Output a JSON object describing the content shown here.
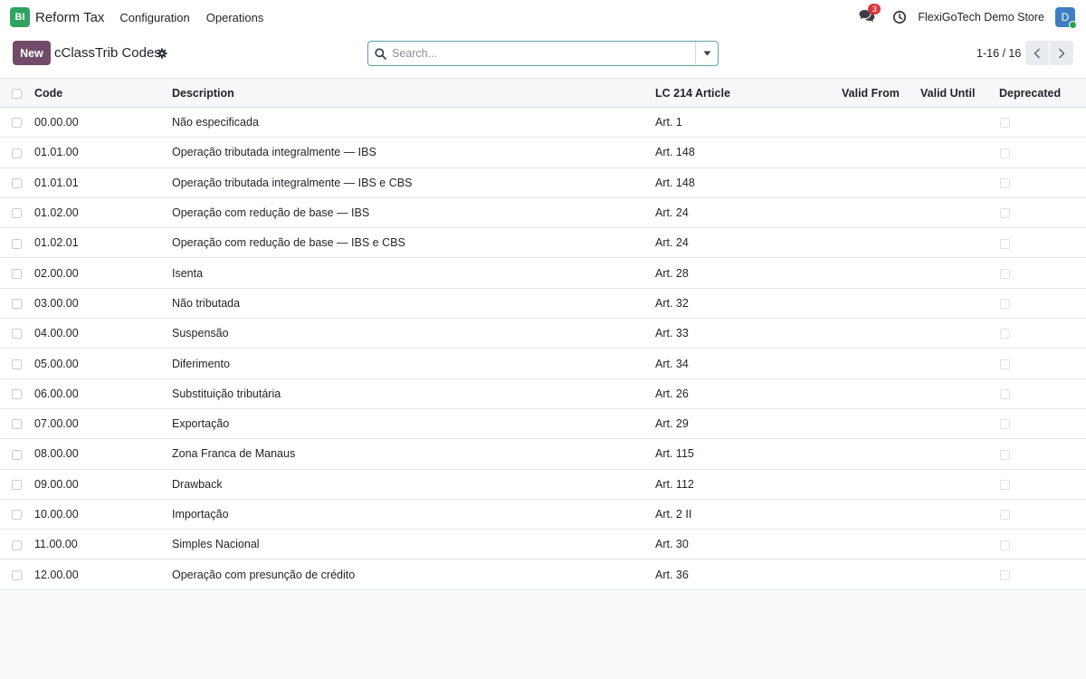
{
  "navbar": {
    "app_logo": "BI",
    "app_name": "Reform Tax",
    "menus": [
      "Configuration",
      "Operations"
    ],
    "messages_badge": "3",
    "company": "FlexiGoTech Demo Store",
    "avatar_letter": "D"
  },
  "control_panel": {
    "new_label": "New",
    "title": "cClassTrib Codes",
    "search_placeholder": "Search...",
    "pager": "1-16 / 16"
  },
  "table": {
    "headers": {
      "code": "Code",
      "description": "Description",
      "article": "LC 214 Article",
      "valid_from": "Valid From",
      "valid_until": "Valid Until",
      "deprecated": "Deprecated"
    },
    "rows": [
      {
        "code": "00.00.00",
        "description": "Não especificada",
        "article": "Art. 1",
        "valid_from": "",
        "valid_until": "",
        "deprecated": false
      },
      {
        "code": "01.01.00",
        "description": "Operação tributada integralmente — IBS",
        "article": "Art. 148",
        "valid_from": "",
        "valid_until": "",
        "deprecated": false
      },
      {
        "code": "01.01.01",
        "description": "Operação tributada integralmente — IBS e CBS",
        "article": "Art. 148",
        "valid_from": "",
        "valid_until": "",
        "deprecated": false
      },
      {
        "code": "01.02.00",
        "description": "Operação com redução de base — IBS",
        "article": "Art. 24",
        "valid_from": "",
        "valid_until": "",
        "deprecated": false
      },
      {
        "code": "01.02.01",
        "description": "Operação com redução de base — IBS e CBS",
        "article": "Art. 24",
        "valid_from": "",
        "valid_until": "",
        "deprecated": false
      },
      {
        "code": "02.00.00",
        "description": "Isenta",
        "article": "Art. 28",
        "valid_from": "",
        "valid_until": "",
        "deprecated": false
      },
      {
        "code": "03.00.00",
        "description": "Não tributada",
        "article": "Art. 32",
        "valid_from": "",
        "valid_until": "",
        "deprecated": false
      },
      {
        "code": "04.00.00",
        "description": "Suspensão",
        "article": "Art. 33",
        "valid_from": "",
        "valid_until": "",
        "deprecated": false
      },
      {
        "code": "05.00.00",
        "description": "Diferimento",
        "article": "Art. 34",
        "valid_from": "",
        "valid_until": "",
        "deprecated": false
      },
      {
        "code": "06.00.00",
        "description": "Substituição tributária",
        "article": "Art. 26",
        "valid_from": "",
        "valid_until": "",
        "deprecated": false
      },
      {
        "code": "07.00.00",
        "description": "Exportação",
        "article": "Art. 29",
        "valid_from": "",
        "valid_until": "",
        "deprecated": false
      },
      {
        "code": "08.00.00",
        "description": "Zona Franca de Manaus",
        "article": "Art. 115",
        "valid_from": "",
        "valid_until": "",
        "deprecated": false
      },
      {
        "code": "09.00.00",
        "description": "Drawback",
        "article": "Art. 112",
        "valid_from": "",
        "valid_until": "",
        "deprecated": false
      },
      {
        "code": "10.00.00",
        "description": "Importação",
        "article": "Art. 2 II",
        "valid_from": "",
        "valid_until": "",
        "deprecated": false
      },
      {
        "code": "11.00.00",
        "description": "Simples Nacional",
        "article": "Art. 30",
        "valid_from": "",
        "valid_until": "",
        "deprecated": false
      },
      {
        "code": "12.00.00",
        "description": "Operação com presunção de crédito",
        "article": "Art. 36",
        "valid_from": "",
        "valid_until": "",
        "deprecated": false
      }
    ]
  },
  "colors": {
    "brand_purple": "#714b67",
    "logo_green": "#2fa35f",
    "badge_red": "#d9363e",
    "avatar_blue": "#3d7fc2",
    "search_border": "#5aa3a6"
  },
  "icons": {
    "messages": "chat-bubbles-icon",
    "activity": "clock-icon",
    "settings": "gear-icon",
    "search": "search-icon",
    "search_toggle": "caret-down-icon",
    "pager_prev": "chevron-left-icon",
    "pager_next": "chevron-right-icon"
  }
}
